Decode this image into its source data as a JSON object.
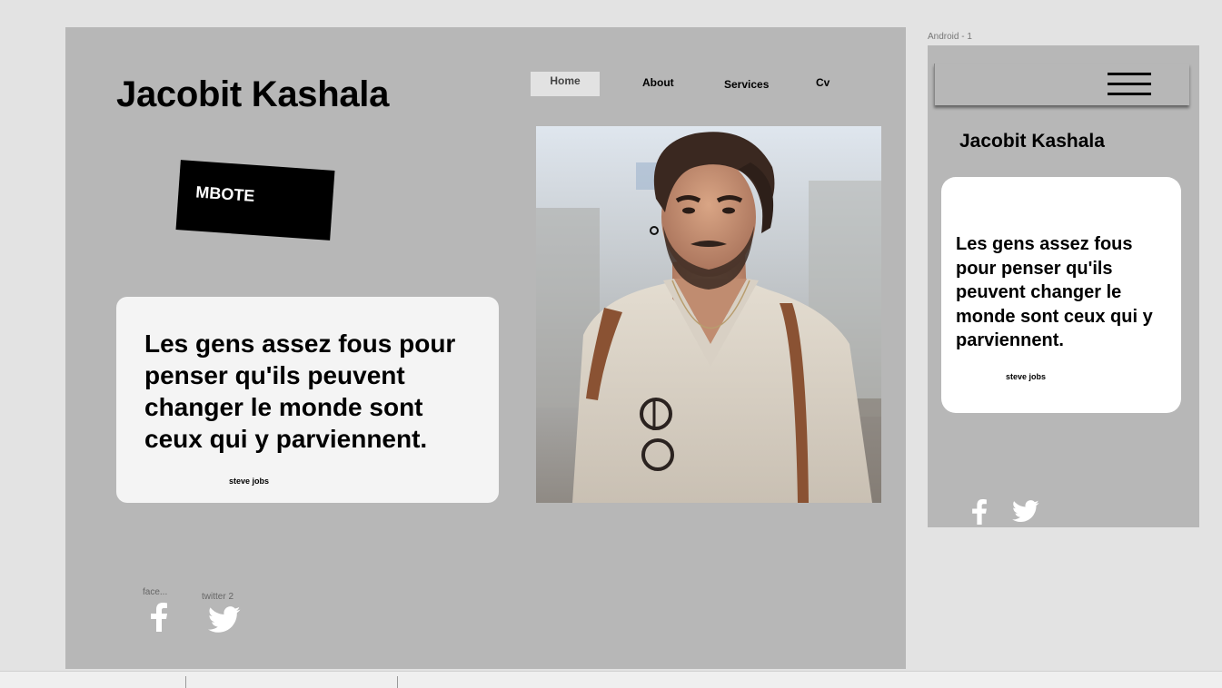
{
  "desktop": {
    "site_title": "Jacobit Kashala",
    "nav": {
      "home": "Home",
      "about": "About",
      "services": "Services",
      "cv": "Cv"
    },
    "badge_label": "MBOTE",
    "quote": {
      "text": "Les gens assez fous pour penser qu'ils peuvent changer le monde sont ceux qui y parviennent.",
      "author": "steve jobs"
    },
    "social": {
      "facebook_label": "face...",
      "twitter_label": "twitter 2"
    }
  },
  "android": {
    "artboard_label": "Android - 1",
    "title": "Jacobit Kashala",
    "quote": {
      "text": "Les gens assez fous pour penser qu'ils peuvent changer le monde sont ceux qui y parviennent.",
      "author": "steve jobs"
    }
  },
  "icons": {
    "menu": "hamburger-menu-icon",
    "facebook": "facebook-icon",
    "twitter": "twitter-icon"
  },
  "colors": {
    "canvas": "#e3e3e3",
    "artboard": "#b7b7b7",
    "card": "#f4f4f4",
    "mobile_card": "#ffffff",
    "text": "#000000",
    "icon": "#ffffff",
    "nav_active_bg": "#e2e2e2"
  }
}
